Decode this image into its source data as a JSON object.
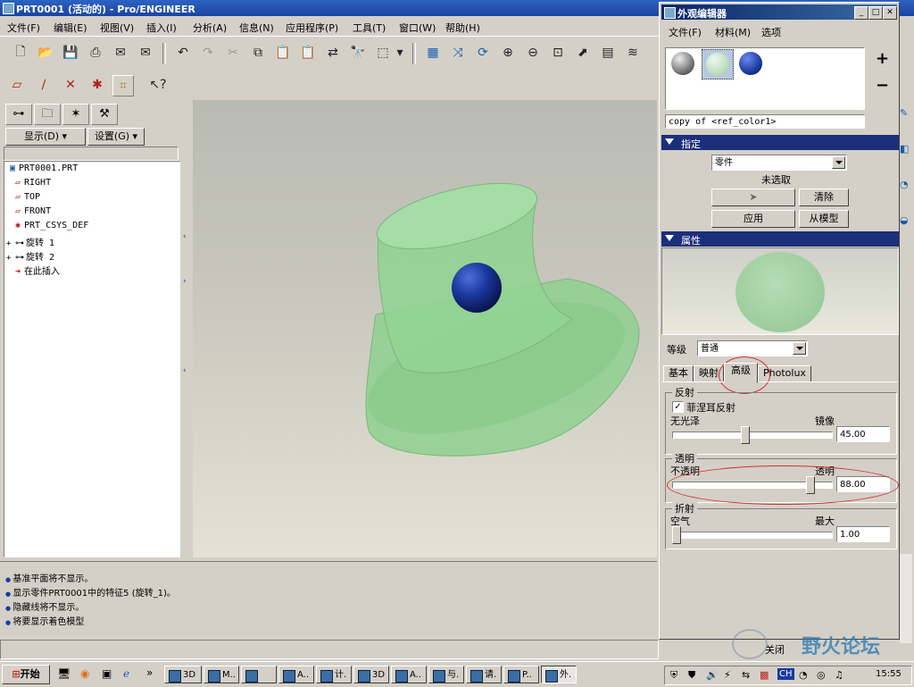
{
  "window": {
    "title": "PRT0001 (活动的) - Pro/ENGINEER"
  },
  "menubar": [
    "文件(F)",
    "编辑(E)",
    "视图(V)",
    "插入(I)",
    "分析(A)",
    "信息(N)",
    "应用程序(P)",
    "工具(T)",
    "窗口(W)",
    "帮助(H)"
  ],
  "navigator": {
    "show_label": "显示(D) ▾",
    "settings_label": "设置(G) ▾",
    "tree": [
      {
        "label": "PRT0001.PRT",
        "icon": "part-icon",
        "expand": ""
      },
      {
        "label": "RIGHT",
        "icon": "datum-plane-icon",
        "expand": ""
      },
      {
        "label": "TOP",
        "icon": "datum-plane-icon",
        "expand": ""
      },
      {
        "label": "FRONT",
        "icon": "datum-plane-icon",
        "expand": ""
      },
      {
        "label": "PRT_CSYS_DEF",
        "icon": "csys-icon",
        "expand": ""
      },
      {
        "label": "旋转 1",
        "icon": "revolve-icon",
        "expand": "+"
      },
      {
        "label": "旋转 2",
        "icon": "revolve-icon",
        "expand": "+"
      },
      {
        "label": "在此插入",
        "icon": "insert-arrow-icon",
        "expand": ""
      }
    ]
  },
  "messages": [
    "基准平面将不显示。",
    "显示零件PRT0001中的特征5 (旋转_1)。",
    "隐藏线将不显示。",
    "将要显示着色模型"
  ],
  "appearance_editor": {
    "title": "外观编辑器",
    "menu": [
      "文件(F)",
      "材料(M)",
      "选项"
    ],
    "add_symbol": "+",
    "remove_symbol": "−",
    "swatch_name": "copy of <ref_color1>",
    "assign_section": {
      "label": "指定",
      "target_value": "零件",
      "selection_status": "未选取",
      "clear_label": "清除",
      "apply_label": "应用",
      "from_model_label": "从模型"
    },
    "properties_section": {
      "label": "属性",
      "level_label": "等级",
      "level_value": "普通",
      "tabs": [
        "基本",
        "映射",
        "高级",
        "Photolux"
      ],
      "active_tab": "高级",
      "reflection": {
        "group_label": "反射",
        "fresnel_label": "菲涅耳反射",
        "fresnel_checked": true,
        "left_label": "无光泽",
        "right_label": "镜像",
        "value": "45.00",
        "level": 0.45
      },
      "transparency": {
        "group_label": "透明",
        "left_label": "不透明",
        "right_label": "透明",
        "value": "88.00",
        "level": 0.88
      },
      "refraction": {
        "group_label": "折射",
        "left_label": "空气",
        "right_label": "最大",
        "value": "1.00",
        "level": 0.0
      }
    },
    "close_label": "关闭"
  },
  "taskbar": {
    "start_label": "开始",
    "tasks": [
      "3D",
      "M..",
      "",
      "A..",
      "计.",
      "3D",
      "A..",
      "与.",
      "请.",
      "P..",
      "外."
    ],
    "clock": "15:55",
    "ime": "CH"
  },
  "watermark": "野火论坛",
  "colors": {
    "model_green": "#8fd08f",
    "sphere_blue": "#1a3aa0",
    "title_blue": "#1c2f7a"
  }
}
